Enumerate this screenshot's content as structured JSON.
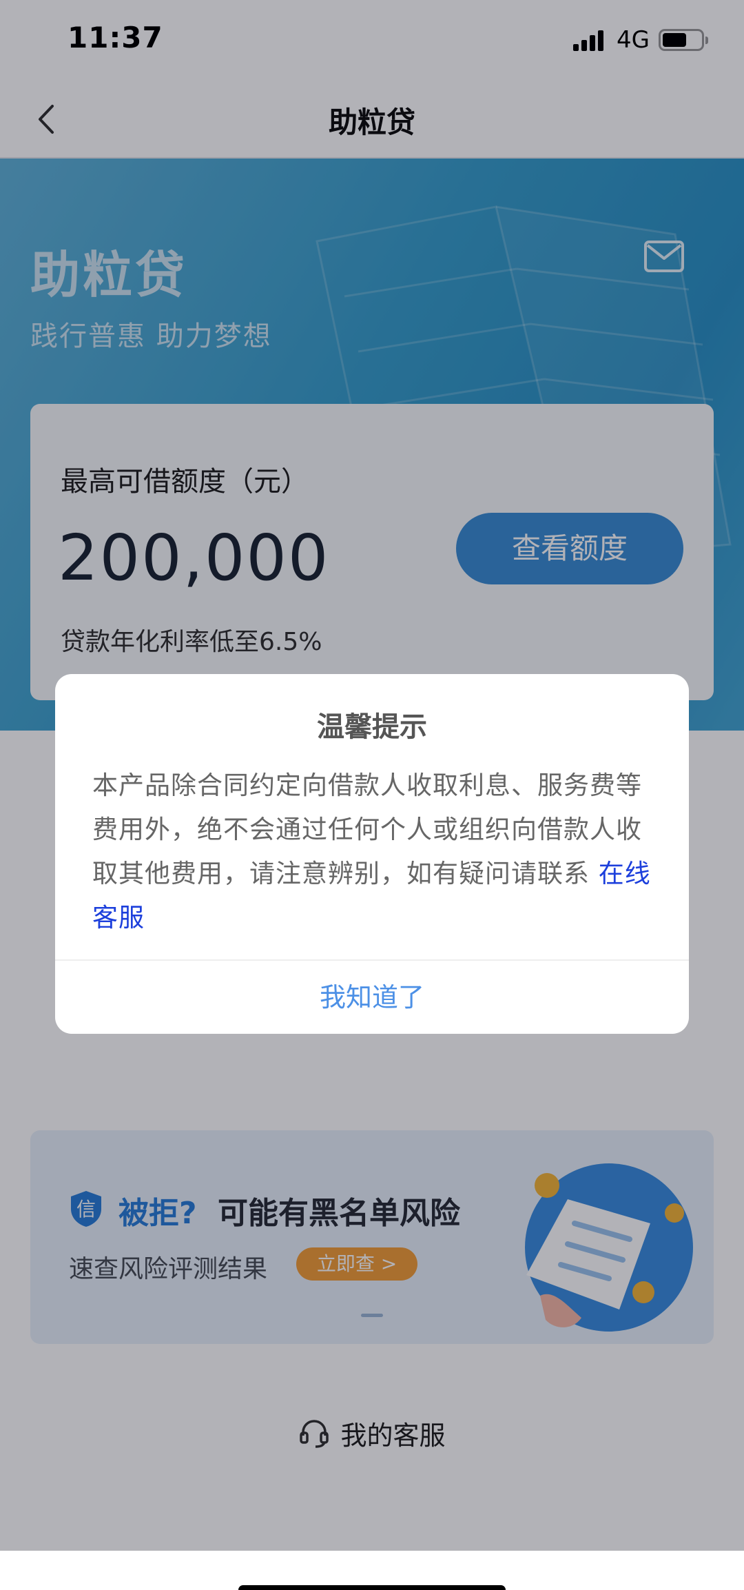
{
  "status_bar": {
    "time": "11:37",
    "network": "4G"
  },
  "nav": {
    "title": "助粒贷"
  },
  "hero": {
    "title": "助粒贷",
    "slogan": "践行普惠 助力梦想"
  },
  "limit_card": {
    "label": "最高可借额度（元）",
    "value": "200,000",
    "button": "查看额度",
    "rate": "贷款年化利率低至6.5%"
  },
  "banner": {
    "title_highlight": "被拒?",
    "title_rest": "可能有黑名单风险",
    "subtitle": "速查风险评测结果",
    "button": "立即查 >"
  },
  "customer_service": {
    "label": "我的客服"
  },
  "dialog": {
    "title": "温馨提示",
    "body": "本产品除合同约定向借款人收取利息、服务费等费用外，绝不会通过任何个人或组织向借款人收取其他费用，请注意辨别，如有疑问请联系 ",
    "link": "在线客服",
    "confirm": "我知道了"
  },
  "colors": {
    "hero_blue": "#3aa0cd",
    "button_blue": "#3d8fd4",
    "link_blue": "#1c3fdc",
    "confirm_blue": "#4c90e6",
    "banner_orange": "#f3a03c"
  },
  "icons": [
    "back-chevron-icon",
    "mail-icon",
    "shield-icon",
    "headset-icon"
  ]
}
